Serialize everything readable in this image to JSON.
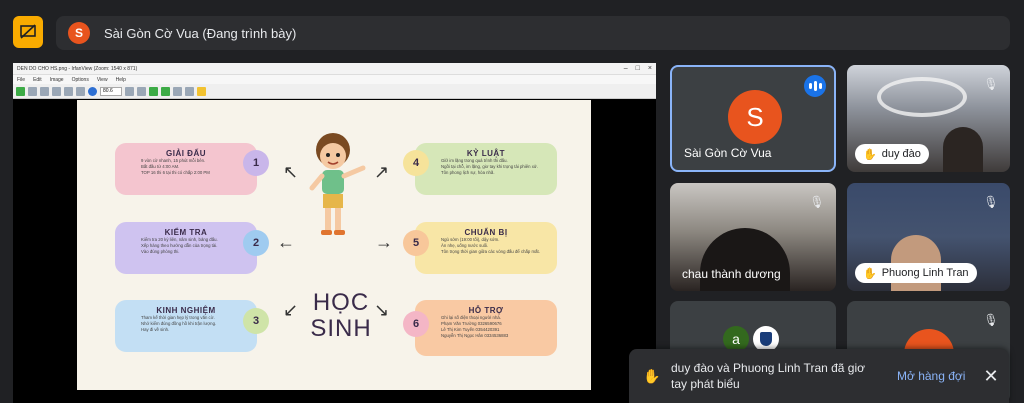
{
  "meeting": {
    "presenter_initial": "S",
    "presenter_title": "Sài Gòn Cờ Vua (Đang trình bày)",
    "accent": "#f9ab00",
    "avatar_color": "#e8541e"
  },
  "share_window": {
    "title": "DEN DO CHO HS.png - IrfanView (Zoom: 1540 x 871)",
    "menu": [
      "File",
      "Edit",
      "Image",
      "Options",
      "View",
      "Help"
    ],
    "zoom": "80.6"
  },
  "slide": {
    "center_line1": "HỌC",
    "center_line2": "SINH",
    "cards": [
      {
        "num": "1",
        "title": "GIẢI ĐẤU",
        "lines": [
          "9 vòn cờ nhanh, 15 phút mỗi bên.",
          "Bắt đầu từ 4:00 AM.",
          "TOP 16 thi 6 tại thi có chấp 2:00 PM"
        ]
      },
      {
        "num": "2",
        "title": "KIỂM TRA",
        "lines": [
          "Kiểm tra 20 kỳ liên, nâm sinh, bảng đấu.",
          "Xếp hàng theo hướng dẫn của trọng tài.",
          "Vào đúng phòng thi."
        ]
      },
      {
        "num": "3",
        "title": "KINH NGHIỆM",
        "lines": [
          "Tham kế thời gian hẹp lý trong văn cờ.",
          "Nhớ kiểm đúng đồng hồ khi trận lượng.",
          "Hay đi về sinh."
        ]
      },
      {
        "num": "4",
        "title": "KỶ LUẬT",
        "lines": [
          "Giữ im lặng trong quá trình thi đấu.",
          "Ngồi tại chỗ, im lặng, giơ tay khi trọng tài phiên xử.",
          "Tôn phong lịch sự, hòa nhã."
        ]
      },
      {
        "num": "5",
        "title": "CHUẨN BỊ",
        "lines": [
          "Ngủ sớm (19:00 tối), dậy sớm.",
          "Ăn nhẹ, uống nước suối.",
          "Tôn trọng thời gian giữa các vòng đấu để chấp mất."
        ]
      },
      {
        "num": "6",
        "title": "HỖ TRỢ",
        "lines": [
          "Ghi lại số điện thoại người nhà.",
          "Phạm Văn Trường 0326590676",
          "Lê Thị Kim Tuyến 0354420391",
          "Nguyễn Thị Ngọc Hân 0334536883"
        ]
      }
    ]
  },
  "participants": [
    {
      "name": "Sài Gòn Cờ Vua",
      "initial": "S"
    },
    {
      "name": "duy đào"
    },
    {
      "name": "chau thành dương"
    },
    {
      "name": "Phuong Linh Tran"
    },
    {
      "initial": "a"
    }
  ],
  "toast": {
    "message": "duy đào và Phuong Linh Tran đã giơ tay phát biểu",
    "action": "Mở hàng đợi"
  }
}
